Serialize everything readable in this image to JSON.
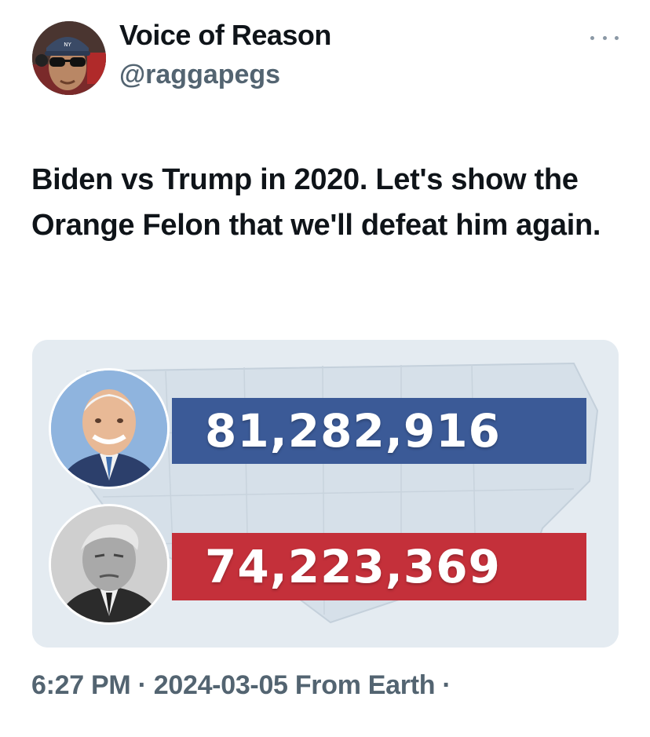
{
  "author": {
    "display_name": "Voice of Reason",
    "handle": "@raggapegs",
    "avatar_icon": "profile-photo-icon"
  },
  "menu_icon": "more-horizontal-icon",
  "tweet": {
    "text": "Biden vs Trump in 2020. Let's show the Orange Felon that we'll defeat him again."
  },
  "media": {
    "candidate_1": {
      "votes": "81,282,916",
      "bar_color": "#3b5a97",
      "portrait_icon": "candidate-portrait-icon"
    },
    "candidate_2": {
      "votes": "74,223,369",
      "bar_color": "#c4303a",
      "portrait_icon": "candidate-portrait-icon"
    },
    "background_icon": "us-map-icon"
  },
  "footer": {
    "time": "6:27 PM",
    "separator": "·",
    "date": "2024-03-05",
    "source": "From Earth"
  },
  "colors": {
    "text_primary": "#0f1419",
    "text_secondary": "#536471"
  }
}
